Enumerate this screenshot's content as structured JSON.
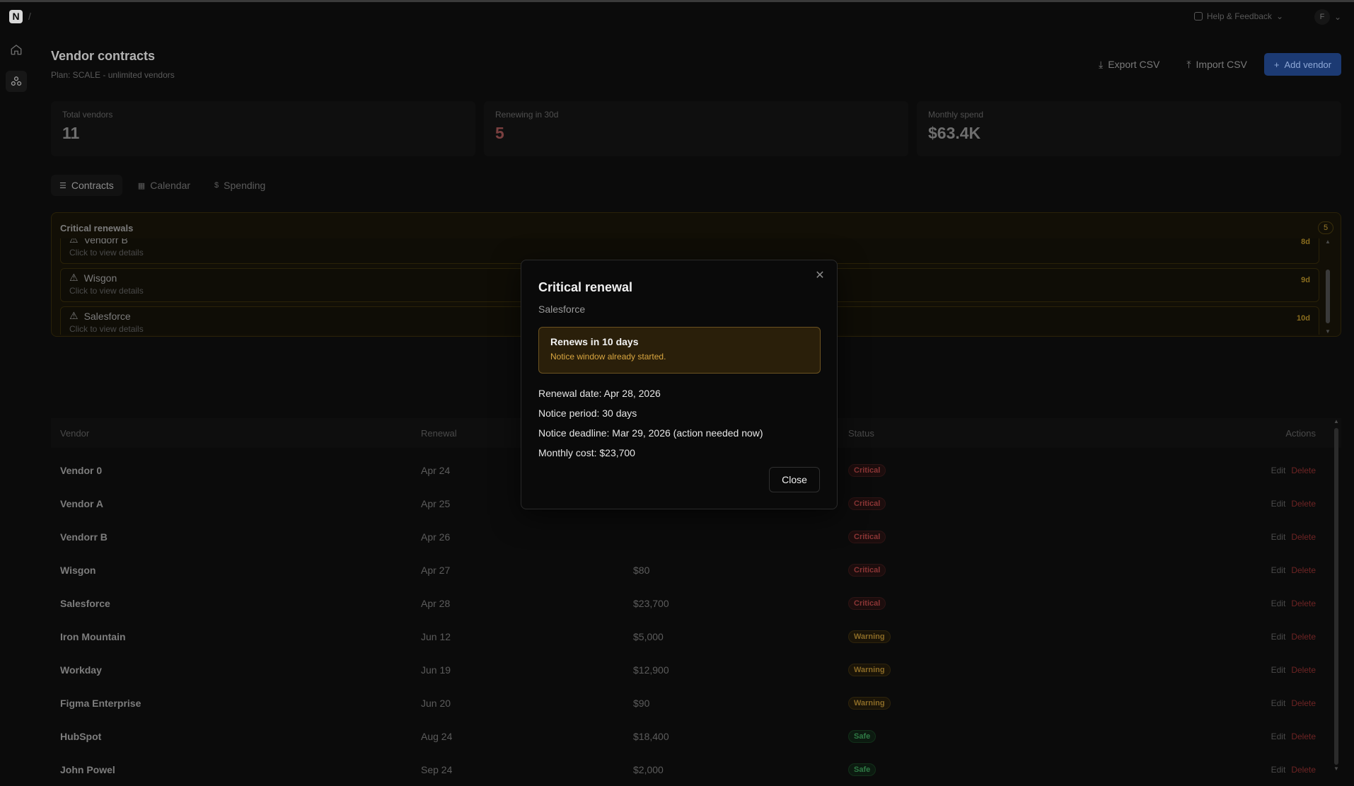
{
  "topbar": {
    "breadcrumb_sep": "/",
    "help_label": "Help & Feedback",
    "user_initial": "F"
  },
  "page": {
    "title": "Vendor contracts",
    "subtitle": "Plan: SCALE - unlimited vendors",
    "export_label": "Export CSV",
    "import_label": "Import CSV",
    "add_label": "Add vendor"
  },
  "stats": [
    {
      "label": "Total vendors",
      "value": "11"
    },
    {
      "label": "Renewing in 30d",
      "value": "5"
    },
    {
      "label": "Monthly spend",
      "value": "$63.4K"
    }
  ],
  "tabs": [
    {
      "label": "Contracts",
      "icon": "list-icon"
    },
    {
      "label": "Calendar",
      "icon": "calendar-icon"
    },
    {
      "label": "Spending",
      "icon": "dollar-icon"
    }
  ],
  "critical": {
    "title": "Critical renewals",
    "count": "5",
    "items": [
      {
        "name": "Vendorr B",
        "hint": "Click to view details",
        "days": "8d"
      },
      {
        "name": "Wisgon",
        "hint": "Click to view details",
        "days": "9d"
      },
      {
        "name": "Salesforce",
        "hint": "Click to view details",
        "days": "10d"
      }
    ]
  },
  "table": {
    "headers": {
      "vendor": "Vendor",
      "renewal": "Renewal",
      "status": "Status",
      "actions": "Actions"
    },
    "edit_label": "Edit",
    "delete_label": "Delete",
    "rows": [
      {
        "vendor": "Vendor 0",
        "renewal": "Apr 24",
        "cost": "",
        "status": "Critical"
      },
      {
        "vendor": "Vendor A",
        "renewal": "Apr 25",
        "cost": "",
        "status": "Critical"
      },
      {
        "vendor": "Vendorr B",
        "renewal": "Apr 26",
        "cost": "",
        "status": "Critical"
      },
      {
        "vendor": "Wisgon",
        "renewal": "Apr 27",
        "cost": "$80",
        "status": "Critical"
      },
      {
        "vendor": "Salesforce",
        "renewal": "Apr 28",
        "cost": "$23,700",
        "status": "Critical"
      },
      {
        "vendor": "Iron Mountain",
        "renewal": "Jun 12",
        "cost": "$5,000",
        "status": "Warning"
      },
      {
        "vendor": "Workday",
        "renewal": "Jun 19",
        "cost": "$12,900",
        "status": "Warning"
      },
      {
        "vendor": "Figma Enterprise",
        "renewal": "Jun 20",
        "cost": "$90",
        "status": "Warning"
      },
      {
        "vendor": "HubSpot",
        "renewal": "Aug 24",
        "cost": "$18,400",
        "status": "Safe"
      },
      {
        "vendor": "John Powel",
        "renewal": "Sep 24",
        "cost": "$2,000",
        "status": "Safe"
      }
    ]
  },
  "modal": {
    "title": "Critical renewal",
    "subtitle": "Salesforce",
    "alert_title": "Renews in 10 days",
    "alert_text": "Notice window already started.",
    "renewal_date": "Renewal date: Apr 28, 2026",
    "notice_period": "Notice period: 30 days",
    "notice_deadline": "Notice deadline: Mar 29, 2026 (action needed now)",
    "monthly_cost": "Monthly cost: $23,700",
    "close_label": "Close"
  }
}
